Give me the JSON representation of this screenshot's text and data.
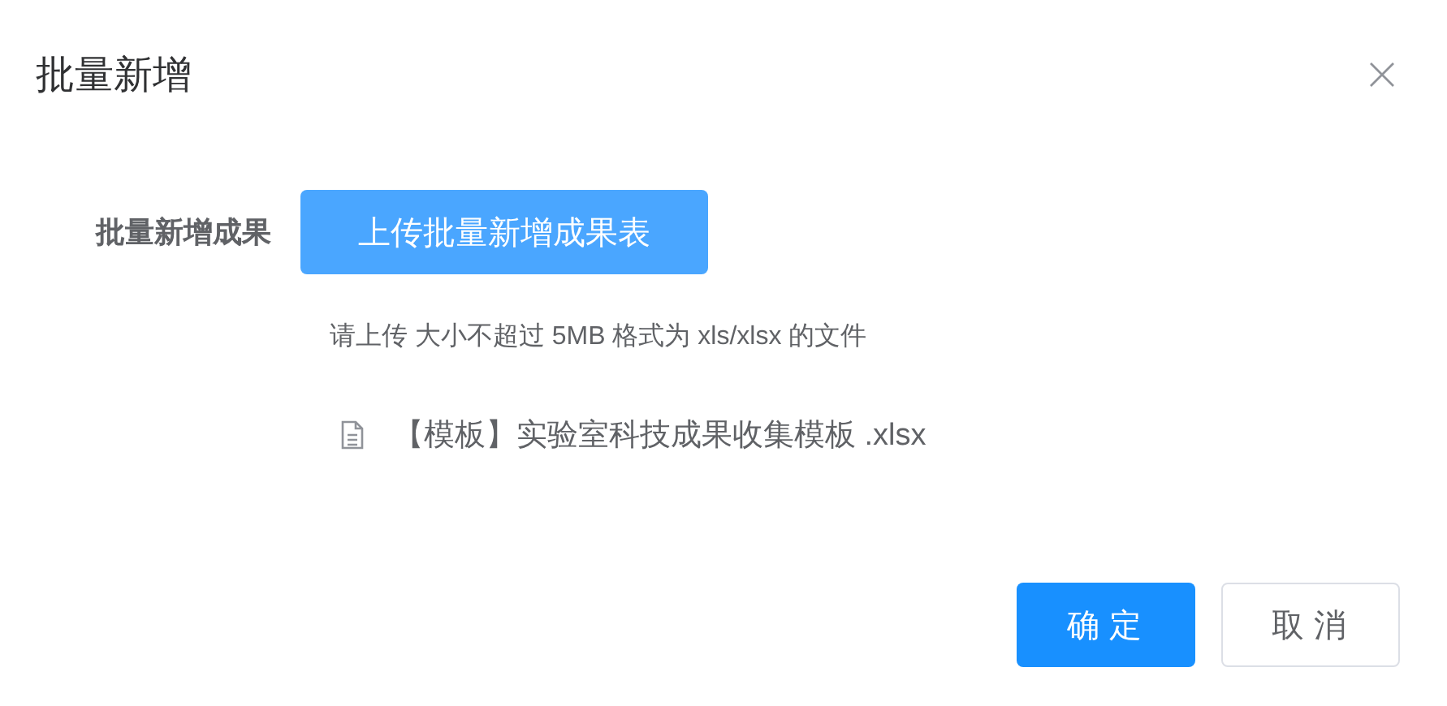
{
  "dialog": {
    "title": "批量新增"
  },
  "form": {
    "label": "批量新增成果",
    "upload_button": "上传批量新增成果表",
    "hint": "请上传 大小不超过 5MB 格式为 xls/xlsx 的文件",
    "files": [
      {
        "name": "【模板】实验室科技成果收集模板 .xlsx"
      }
    ]
  },
  "buttons": [
    {
      "label": "确定",
      "kind": "primary"
    },
    {
      "label": "取消",
      "kind": "default"
    }
  ]
}
